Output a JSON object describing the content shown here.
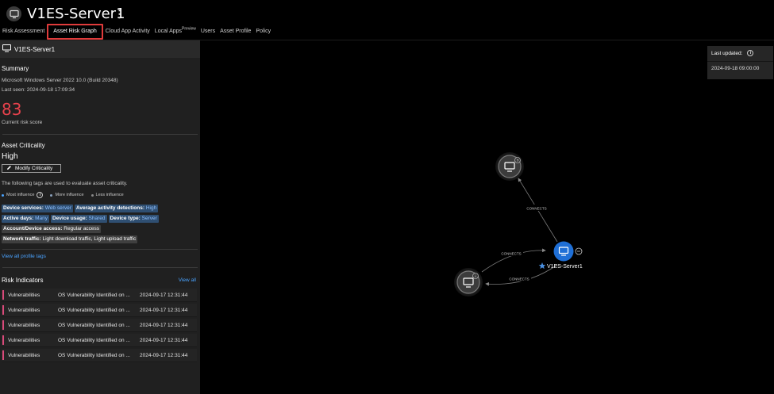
{
  "header": {
    "title": "V1ES-Server1",
    "more_icon": "more-vertical-icon",
    "asset_icon": "monitor-icon"
  },
  "tabs": [
    {
      "label": "Risk Assessment",
      "badge": "",
      "active": false
    },
    {
      "label": "Asset Risk Graph",
      "badge": "",
      "active": true
    },
    {
      "label": "Cloud App Activity",
      "badge": "",
      "active": false
    },
    {
      "label": "Local Apps",
      "badge": "Preview",
      "active": false
    },
    {
      "label": "Users",
      "badge": "",
      "active": false
    },
    {
      "label": "Asset Profile",
      "badge": "",
      "active": false
    },
    {
      "label": "Policy",
      "badge": "",
      "active": false
    }
  ],
  "panel": {
    "asset_name": "V1ES-Server1",
    "summary": {
      "title": "Summary",
      "os": "Microsoft Windows Server 2022 10.0 (Build 20348)",
      "last_seen": "Last seen: 2024-09-18 17:09:34",
      "risk_score": "83",
      "risk_score_label": "Current risk score"
    },
    "criticality": {
      "title": "Asset Criticality",
      "value": "High",
      "modify_label": "Modify Criticality",
      "tags_intro": "The following tags are used to evaluate asset criticality.",
      "legend": {
        "most": "Most influence",
        "more": "More influence",
        "less": "Less influence"
      },
      "tag_rows": [
        [
          {
            "key": "Device services:",
            "value": "Web server",
            "level": "most"
          },
          {
            "key": "Average activity detections:",
            "value": "High",
            "level": "most"
          }
        ],
        [
          {
            "key": "Active days:",
            "value": "Many",
            "level": "most"
          },
          {
            "key": "Device usage:",
            "value": "Shared",
            "level": "most"
          },
          {
            "key": "Device type:",
            "value": "Server",
            "level": "most"
          }
        ],
        [
          {
            "key": "Account/Device access:",
            "value": "Regular access",
            "level": "less"
          }
        ],
        [
          {
            "key": "Network traffic:",
            "value": "Light download traffic, Light upload traffic",
            "level": "less"
          }
        ]
      ],
      "view_all_tags": "View all profile tags"
    },
    "risk_indicators": {
      "title": "Risk Indicators",
      "view_all": "View all",
      "rows": [
        {
          "category": "Vulnerabilities",
          "description": "OS Vulnerability Identified on ...",
          "time": "2024-09-17 12:31:44"
        },
        {
          "category": "Vulnerabilities",
          "description": "OS Vulnerability Identified on ...",
          "time": "2024-09-17 12:31:44"
        },
        {
          "category": "Vulnerabilities",
          "description": "OS Vulnerability Identified on ...",
          "time": "2024-09-17 12:31:44"
        },
        {
          "category": "Vulnerabilities",
          "description": "OS Vulnerability Identified on ...",
          "time": "2024-09-17 12:31:44"
        },
        {
          "category": "Vulnerabilities",
          "description": "OS Vulnerability Identified on ...",
          "time": "2024-09-17 12:31:44"
        }
      ]
    }
  },
  "graph": {
    "last_updated_label": "Last updated:",
    "last_updated_value": "2024-09-18 09:00:00",
    "main_node_label": "V1ES-Server1",
    "edge_label": "CONNECTS",
    "colors": {
      "main_node": "#1f6fd6",
      "risk_bar": "#d94a7a",
      "risk_score": "#e8424c",
      "active_tab_border": "#e03b3b"
    }
  }
}
